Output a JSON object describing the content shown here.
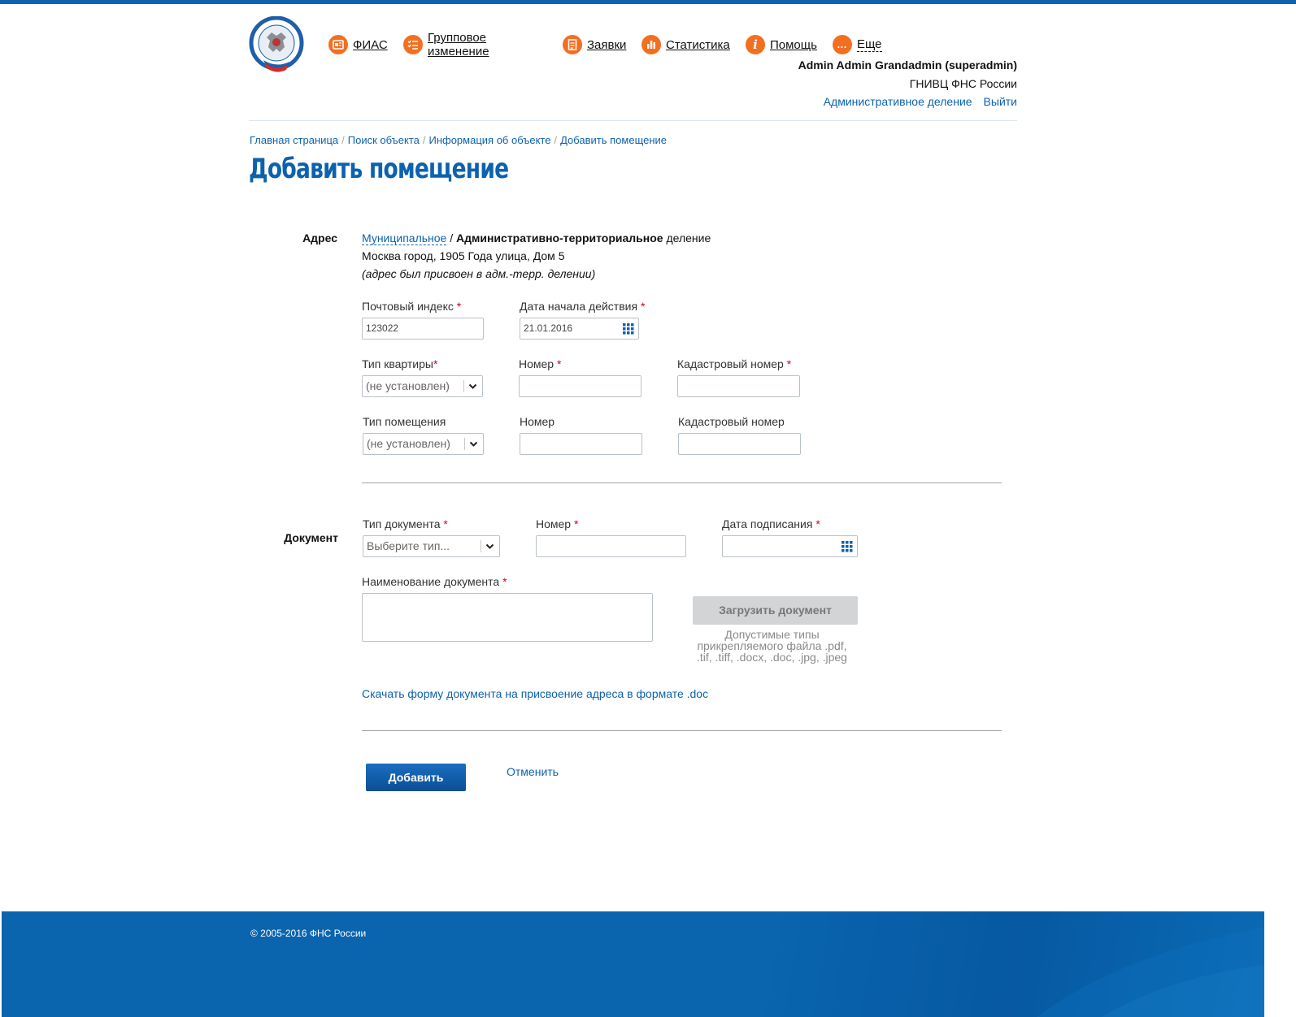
{
  "colors": {
    "brand": "#0d62ad",
    "accent": "#f26f21",
    "required": "#d0021b",
    "footer": "#0a64ae"
  },
  "nav": [
    {
      "label": "ФИАС",
      "icon": "book-icon"
    },
    {
      "label": "Групповое изменение",
      "icon": "checklist-icon"
    },
    {
      "label": "Заявки",
      "icon": "document-icon"
    },
    {
      "label": "Статистика",
      "icon": "bar-chart-icon"
    },
    {
      "label": "Помощь",
      "icon": "info-icon"
    },
    {
      "label": "Еще",
      "icon": "more-icon"
    }
  ],
  "header": {
    "user": "Admin Admin Grandadmin (superadmin)",
    "org": "ГНИВЦ ФНС России",
    "links": {
      "division": "Административное деление",
      "logout": "Выйти"
    }
  },
  "breadcrumb": [
    "Главная страница",
    "Поиск объекта",
    "Информация об объекте",
    "Добавить помещение"
  ],
  "page": {
    "title": "Добавить помещение"
  },
  "address": {
    "label": "Адрес",
    "division_mun": "Муниципальное",
    "division_sep": " / ",
    "division_adm": "Административно-территориальное",
    "division_tail": " деление",
    "line": "Москва город, 1905 Года улица, Дом 5",
    "note": "(адрес был присвоен в адм.-терр. делении)",
    "postal": {
      "label": "Почтовый индекс",
      "value": "123022"
    },
    "start_date": {
      "label": "Дата начала действия",
      "value": "21.01.2016"
    },
    "apt_type": {
      "label": "Тип квартиры",
      "value": "(не установлен)"
    },
    "apt_number": {
      "label": "Номер",
      "value": ""
    },
    "apt_cadastral": {
      "label": "Кадастровый номер",
      "value": ""
    },
    "room_type": {
      "label": "Тип помещения",
      "value": "(не установлен)"
    },
    "room_number": {
      "label": "Номер",
      "value": ""
    },
    "room_cadastral": {
      "label": "Кадастровый номер",
      "value": ""
    }
  },
  "document": {
    "label": "Документ",
    "type": {
      "label": "Тип документа",
      "placeholder": "Выберите тип..."
    },
    "number": {
      "label": "Номер",
      "value": ""
    },
    "sign_date": {
      "label": "Дата подписания",
      "value": ""
    },
    "name": {
      "label": "Наименование документа",
      "value": ""
    },
    "upload_label": "Загрузить документ",
    "upload_hint": "Допустимые типы прикрепляемого файла .pdf, .tif, .tiff, .docx, .doc, .jpg, .jpeg",
    "download_link": "Скачать форму документа на присвоение адреса в формате .doc"
  },
  "actions": {
    "add": "Добавить",
    "cancel": "Отменить"
  },
  "footer": {
    "copyright": "© 2005-2016 ФНС России"
  },
  "required_mark": "*"
}
